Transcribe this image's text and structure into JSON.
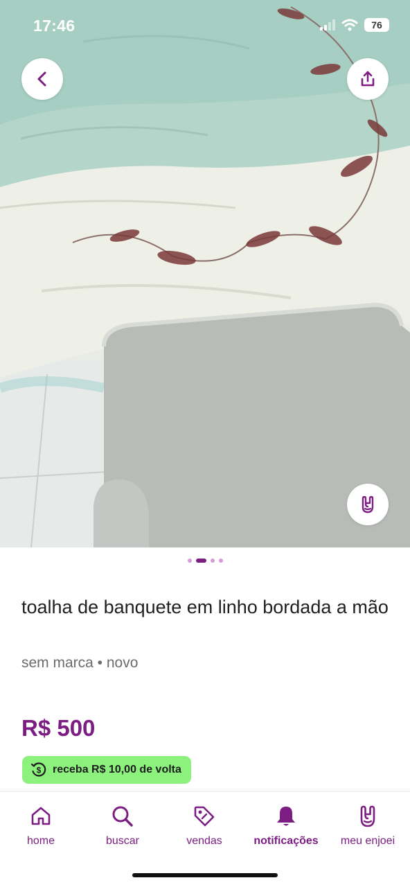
{
  "status_bar": {
    "time": "17:46",
    "battery": "76"
  },
  "product": {
    "title": "toalha de banquete em linho bordada a mão",
    "meta": "sem marca • novo",
    "price": "R$ 500",
    "cashback": "receba R$ 10,00 de volta"
  },
  "carousel": {
    "count": 4,
    "active": 1
  },
  "nav": {
    "items": [
      {
        "label": "home",
        "icon": "house-icon"
      },
      {
        "label": "buscar",
        "icon": "search-icon"
      },
      {
        "label": "vendas",
        "icon": "tag-icon"
      },
      {
        "label": "notificações",
        "icon": "bell-icon",
        "active": true
      },
      {
        "label": "meu enjoei",
        "icon": "rock-hand-icon"
      }
    ]
  },
  "colors": {
    "brand": "#7b1d82",
    "cashback_bg": "#8cf27d"
  }
}
